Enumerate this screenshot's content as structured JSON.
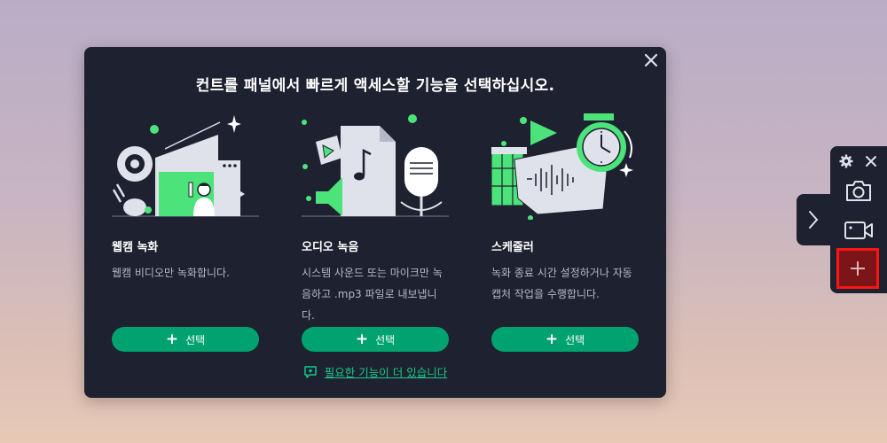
{
  "dialog": {
    "title": "컨트롤 패널에서 빠르게 액세스할 기능을 선택하십시오.",
    "close_icon": "close-icon",
    "cards": [
      {
        "title": "웹캠 녹화",
        "desc": "웹캠 비디오만 녹화합니다.",
        "button": "선택"
      },
      {
        "title": "오디오 녹음",
        "desc": "시스템 사운드 또는 마이크만 녹음하고 .mp3 파일로 내보냅니다.",
        "button": "선택"
      },
      {
        "title": "스케줄러",
        "desc": "녹화 종료 시간 설정하거나 자동 캡처 작업을 수행합니다.",
        "button": "선택"
      }
    ],
    "more_link": "필요한 기능이 더 있습니다"
  },
  "side_panel": {
    "icons": [
      "gear-icon",
      "close-icon",
      "chevron-right-icon",
      "camera-icon",
      "video-camera-icon",
      "plus-icon"
    ]
  },
  "colors": {
    "dialog_bg": "#1d2130",
    "accent_green": "#00a36f",
    "link_green": "#18c98a",
    "highlight_red": "#ff1414"
  }
}
